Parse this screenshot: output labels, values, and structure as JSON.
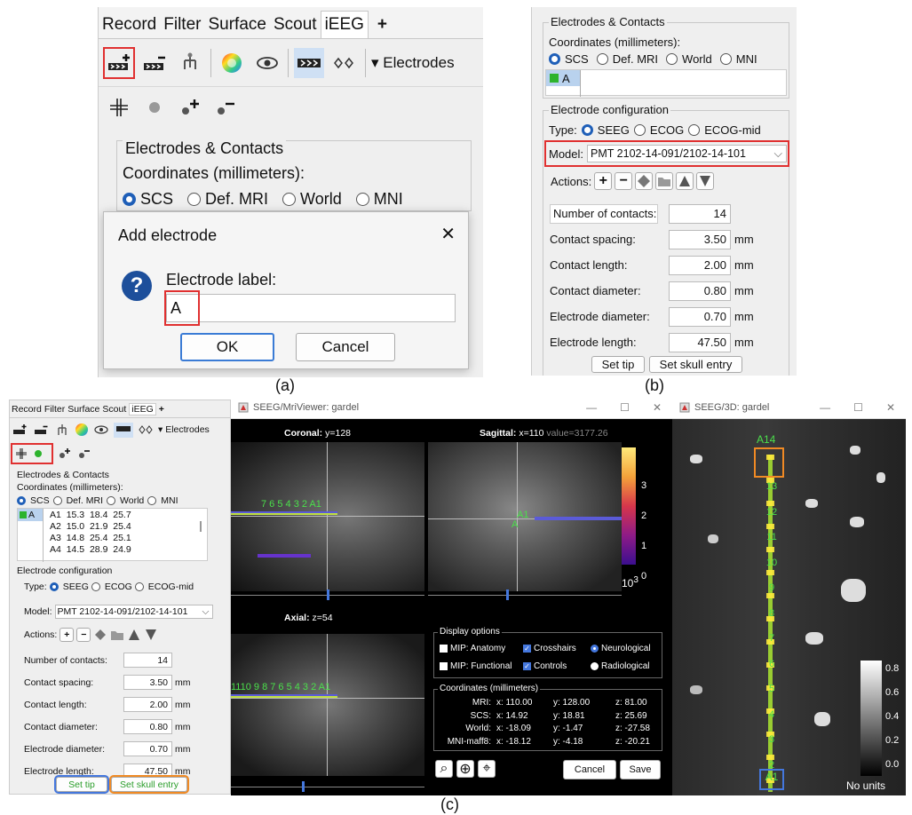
{
  "captions": {
    "a": "(a)",
    "b": "(b)",
    "c": "(c)"
  },
  "panel_a": {
    "tabs": [
      "Record",
      "Filter",
      "Surface",
      "Scout",
      "iEEG",
      "+"
    ],
    "selected_tab": "iEEG",
    "toolbar_dropdown": "▾ Electrodes",
    "group_title": "Electrodes & Contacts",
    "coords_label": "Coordinates (millimeters):",
    "radios": [
      "SCS",
      "Def. MRI",
      "World",
      "MNI"
    ],
    "dialog": {
      "title": "Add electrode",
      "close": "✕",
      "question": "?",
      "label": "Electrode label:",
      "value": "A",
      "ok": "OK",
      "cancel": "Cancel"
    }
  },
  "panel_b": {
    "group_title": "Electrodes & Contacts",
    "coords_label": "Coordinates (millimeters):",
    "radios": [
      "SCS",
      "Def. MRI",
      "World",
      "MNI"
    ],
    "electrode_item": "A",
    "config_title": "Electrode configuration",
    "type_label": "Type:",
    "types": [
      "SEEG",
      "ECOG",
      "ECOG-mid"
    ],
    "model_label": "Model:",
    "model_value": "PMT 2102-14-091/2102-14-101",
    "actions_label": "Actions:",
    "fields": [
      {
        "label": "Number of contacts:",
        "value": "14",
        "unit": ""
      },
      {
        "label": "Contact spacing:",
        "value": "3.50",
        "unit": "mm"
      },
      {
        "label": "Contact length:",
        "value": "2.00",
        "unit": "mm"
      },
      {
        "label": "Contact diameter:",
        "value": "0.80",
        "unit": "mm"
      },
      {
        "label": "Electrode diameter:",
        "value": "0.70",
        "unit": "mm"
      },
      {
        "label": "Electrode length:",
        "value": "47.50",
        "unit": "mm"
      }
    ],
    "set_tip": "Set tip",
    "set_skull": "Set skull entry"
  },
  "panel_c_left": {
    "tabs": [
      "Record",
      "Filter",
      "Surface",
      "Scout",
      "iEEG",
      "+"
    ],
    "toolbar_dropdown": "▾ Electrodes",
    "group_title": "Electrodes & Contacts",
    "coords_label": "Coordinates (millimeters):",
    "radios": [
      "SCS",
      "Def. MRI",
      "World",
      "MNI"
    ],
    "electrode_item": "A",
    "contacts": [
      {
        "name": "A1",
        "x": "15.3",
        "y": "18.4",
        "z": "25.7"
      },
      {
        "name": "A2",
        "x": "15.0",
        "y": "21.9",
        "z": "25.4"
      },
      {
        "name": "A3",
        "x": "14.8",
        "y": "25.4",
        "z": "25.1"
      },
      {
        "name": "A4",
        "x": "14.5",
        "y": "28.9",
        "z": "24.9"
      }
    ],
    "config_title": "Electrode configuration",
    "type_label": "Type:",
    "types": [
      "SEEG",
      "ECOG",
      "ECOG-mid"
    ],
    "model_label": "Model:",
    "model_value": "PMT 2102-14-091/2102-14-101",
    "actions_label": "Actions:",
    "fields": [
      {
        "label": "Number of contacts:",
        "value": "14",
        "unit": ""
      },
      {
        "label": "Contact spacing:",
        "value": "3.50",
        "unit": "mm"
      },
      {
        "label": "Contact length:",
        "value": "2.00",
        "unit": "mm"
      },
      {
        "label": "Contact diameter:",
        "value": "0.80",
        "unit": "mm"
      },
      {
        "label": "Electrode diameter:",
        "value": "0.70",
        "unit": "mm"
      },
      {
        "label": "Electrode length:",
        "value": "47.50",
        "unit": "mm"
      }
    ],
    "set_tip": "Set tip",
    "set_skull": "Set skull entry"
  },
  "mri_viewer": {
    "window_title": "SEEG/MriViewer: gardel",
    "coronal_label": "Coronal:",
    "coronal_val": "y=128",
    "sagittal_label": "Sagittal:",
    "sagittal_val": "x=110",
    "sagittal_value": "value=3177.26",
    "axial_label": "Axial:",
    "axial_val": "z=54",
    "coronal_contacts": "7 6 5 4 3 2 A1",
    "axial_contacts": "1110 9 8 7 6 5 4 3 2 A1",
    "sag_contact1": "A1",
    "sag_contact2": "A",
    "colorbar_ticks": [
      "3",
      "2",
      "1",
      "0"
    ],
    "colorbar_exp": "10",
    "colorbar_exp_sup": "3",
    "display_title": "Display options",
    "opt_mip_anat": "MIP: Anatomy",
    "opt_crosshairs": "Crosshairs",
    "opt_neuro": "Neurological",
    "opt_mip_func": "MIP: Functional",
    "opt_controls": "Controls",
    "opt_radio": "Radiological",
    "coords_title": "Coordinates (millimeters)",
    "coords": [
      {
        "label": "MRI:",
        "x": "x: 110.00",
        "y": "y: 128.00",
        "z": "z: 81.00"
      },
      {
        "label": "SCS:",
        "x": "x: 14.92",
        "y": "y: 18.81",
        "z": "z: 25.69"
      },
      {
        "label": "World:",
        "x": "x: -18.09",
        "y": "y: -1.47",
        "z": "z: -27.58"
      },
      {
        "label": "MNI-maff8:",
        "x": "x: -18.12",
        "y": "y: -4.18",
        "z": "z: -20.21"
      }
    ],
    "cancel": "Cancel",
    "save": "Save"
  },
  "viewer3d": {
    "window_title": "SEEG/3D: gardel",
    "top_label": "A14",
    "contact_labels": [
      "13",
      "12",
      "11",
      "10",
      "9",
      "8",
      "7",
      "6",
      "5",
      "4",
      "3",
      "2"
    ],
    "bottom_label": "A1",
    "colorbar_ticks": [
      "0.8",
      "0.6",
      "0.4",
      "0.2",
      "0.0"
    ],
    "units": "No units"
  }
}
